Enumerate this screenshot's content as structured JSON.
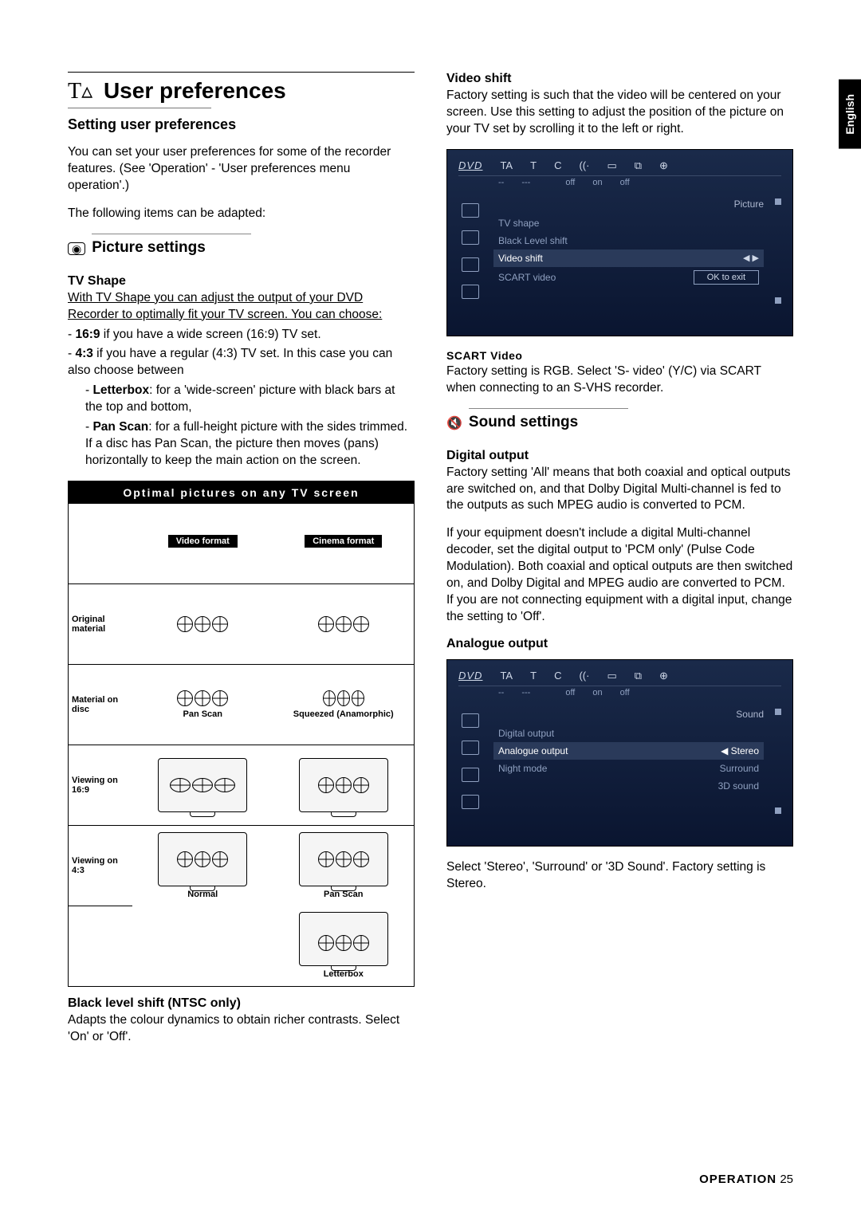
{
  "lang_tab": "English",
  "title": "User preferences",
  "subtitle": "Setting user preferences",
  "intro1": "You can set your user preferences for some of the recorder features. (See 'Operation' - 'User preferences menu operation'.)",
  "intro2": "The following items can be adapted:",
  "picture": {
    "heading": "Picture settings",
    "tvshape_h": "TV Shape",
    "tvshape_p1": "With TV Shape you can adjust the output of your DVD Recorder to optimally fit your TV screen. You can choose:",
    "opt169_label": "16:9",
    "opt169_text": " if you have a wide screen (16:9) TV set.",
    "opt43_label": "4:3",
    "opt43_text": " if you have a regular (4:3) TV set. In this case you can also choose between",
    "letterbox_label": "Letterbox",
    "letterbox_text": ": for a 'wide-screen' picture with black bars at the top and bottom,",
    "panscan_label": "Pan Scan",
    "panscan_text": ": for a full-height picture with the sides trimmed. If a disc has Pan Scan, the picture then moves (pans) horizontally to keep the main action on the screen."
  },
  "diagram": {
    "title": "Optimal pictures on any TV screen",
    "col1": "Video format",
    "col2": "Cinema format",
    "row1": "Original material",
    "row2": "Material on disc",
    "row2_cap1": "Pan Scan",
    "row2_cap2": "Squeezed (Anamorphic)",
    "row3": "Viewing on 16:9",
    "row4": "Viewing on 4:3",
    "row4_cap1": "Normal",
    "row4_cap2": "Pan Scan",
    "row5_cap": "Letterbox"
  },
  "blacklevel_h": "Black level shift (NTSC only)",
  "blacklevel_p": "Adapts the colour dynamics to obtain richer contrasts. Select 'On' or 'Off'.",
  "videoshift_h": "Video shift",
  "videoshift_p": "Factory setting is such that the video will be centered on your screen. Use this setting to adjust the position of the picture on your TV set by scrolling it to the left or right.",
  "osd1": {
    "top": {
      "logo": "DVD",
      "t1": "TA",
      "t2": "T",
      "t3": "C",
      "t4": "((·",
      "t5": "▭",
      "t6": "⧉",
      "t7": "⊕"
    },
    "row2": {
      "a": "--",
      "b": "---",
      "c": "",
      "d": "off",
      "e": "on",
      "f": "off"
    },
    "heading": "Picture",
    "items": [
      "TV shape",
      "Black Level shift",
      "Video shift",
      "SCART video"
    ],
    "selected": 2,
    "sel_control": "◀ ▶",
    "pill": "OK to exit"
  },
  "scart_h": "SCART Video",
  "scart_p": "Factory setting is RGB. Select 'S-    video' (Y/C) via SCART when connecting to an S-VHS recorder.",
  "sound": {
    "heading": "Sound settings",
    "digital_h": "Digital output",
    "digital_p1": "Factory setting 'All' means that both coaxial and optical outputs are switched on, and that Dolby Digital Multi-channel is fed to the outputs as such MPEG audio is converted to PCM.",
    "digital_p2": "If your equipment doesn't include a digital Multi-channel decoder, set the digital output to 'PCM only' (Pulse Code Modulation). Both coaxial and optical outputs are then switched on, and Dolby Digital and MPEG audio are converted to PCM. If you are not connecting equipment with a digital input, change the setting to 'Off'.",
    "analogue_h": "Analogue output"
  },
  "osd2": {
    "heading": "Sound",
    "items": [
      "Digital output",
      "Analogue output",
      "Night mode"
    ],
    "selected": 1,
    "options": [
      "Stereo",
      "Surround",
      "3D sound"
    ],
    "opt_selected": 0
  },
  "analogue_tail": "Select 'Stereo', 'Surround' or '3D Sound'. Factory setting is Stereo.",
  "footer": {
    "label": "OPERATION",
    "page": "25"
  }
}
